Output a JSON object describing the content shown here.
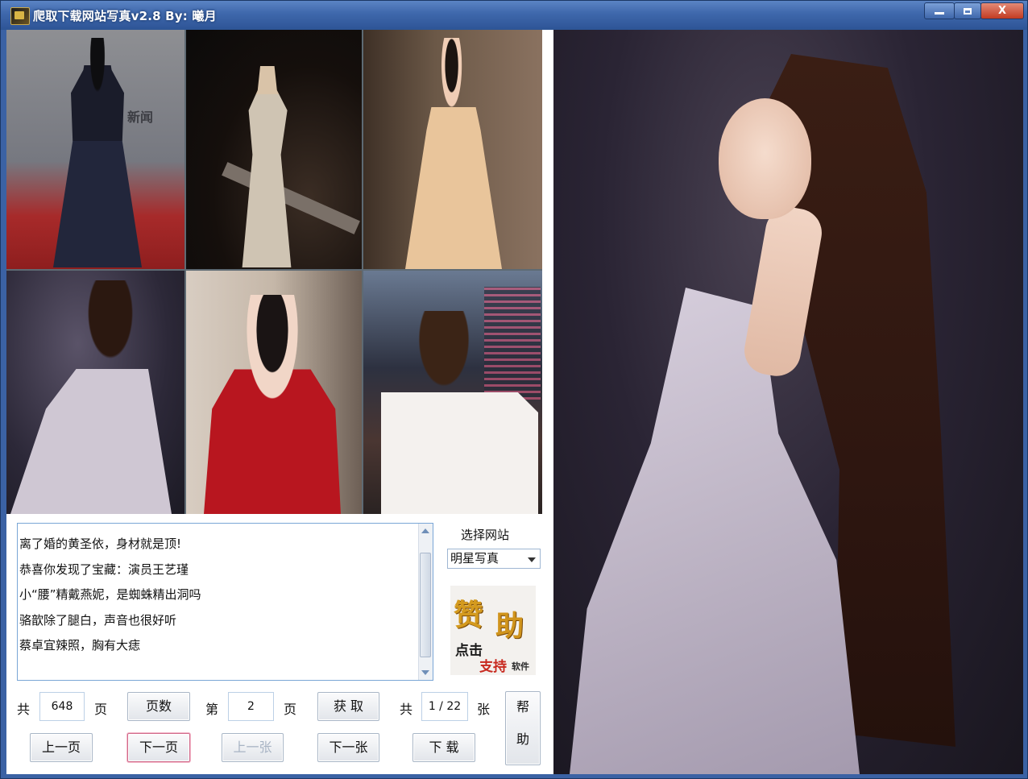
{
  "window": {
    "title": "爬取下载网站写真v2.8    By:  曦月",
    "controls": {
      "minimize": "minimize",
      "maximize": "maximize",
      "close": "X"
    }
  },
  "thumbnails": [
    {
      "caption": ""
    },
    {
      "caption": ""
    },
    {
      "caption": ""
    },
    {
      "caption": ""
    },
    {
      "caption": ""
    },
    {
      "caption": ""
    }
  ],
  "thumb1_sign_text": "新闻",
  "news_list": [
    "离了婚的黄圣依，身材就是顶!",
    "恭喜你发现了宝藏：演员王艺瑾",
    "小“腰”精戴燕妮，是蜘蛛精出洞吗",
    "骆歆除了腿白，声音也很好听",
    "蔡卓宜辣照，胸有大痣"
  ],
  "site_selector": {
    "label": "选择网站",
    "selected": "明星写真"
  },
  "sponsor": {
    "big1": "赞",
    "big2": "助",
    "line1": "点击",
    "line2": "支持",
    "line3": "软件"
  },
  "pager": {
    "total_prefix": "共",
    "total_pages": "648",
    "page_unit": "页",
    "pages_button": "页数",
    "current_prefix": "第",
    "current_page": "2",
    "current_unit": "页",
    "fetch_button": "获 取",
    "images_prefix": "共",
    "image_counter": "1 / 22",
    "images_unit": "张",
    "help_button_line1": "帮",
    "help_button_line2": "助",
    "prev_page_button": "上一页",
    "next_page_button": "下一页",
    "prev_image_button": "上一张",
    "next_image_button": "下一张",
    "download_button": "下 载"
  }
}
